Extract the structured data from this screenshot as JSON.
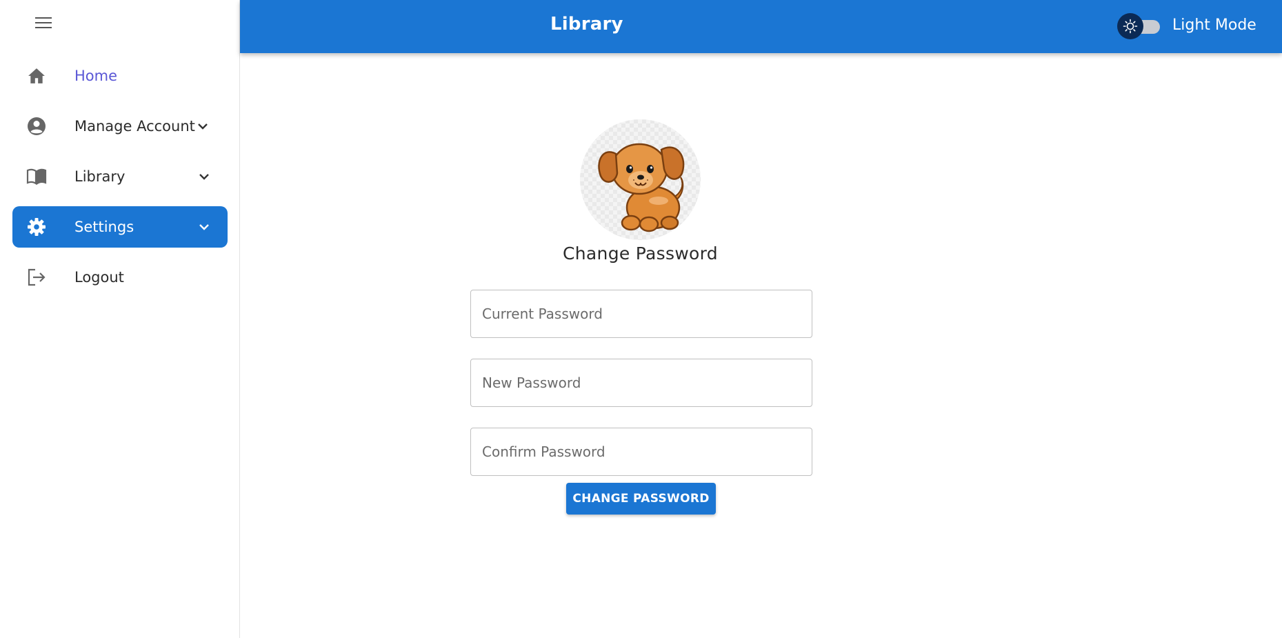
{
  "app": {
    "title": "Library"
  },
  "sidebar": {
    "items": [
      {
        "label": "Home",
        "icon": "home-icon"
      },
      {
        "label": "Manage Account",
        "icon": "account-circle-icon"
      },
      {
        "label": "Library",
        "icon": "book-open-icon"
      },
      {
        "label": "Settings",
        "icon": "gear-icon",
        "active": true
      },
      {
        "label": "Logout",
        "icon": "logout-icon"
      }
    ]
  },
  "header": {
    "title": "Library",
    "theme_toggle": {
      "label": "Light Mode",
      "checked": false
    }
  },
  "form": {
    "title": "Change Password",
    "current_password": {
      "placeholder": "Current Password",
      "value": ""
    },
    "new_password": {
      "placeholder": "New Password",
      "value": ""
    },
    "confirm_password": {
      "placeholder": "Confirm Password",
      "value": ""
    },
    "submit_label": "CHANGE PASSWORD"
  },
  "colors": {
    "primary": "#1b76d3",
    "active_link": "#5a57d6",
    "toggle_knob": "#0b2a55"
  }
}
